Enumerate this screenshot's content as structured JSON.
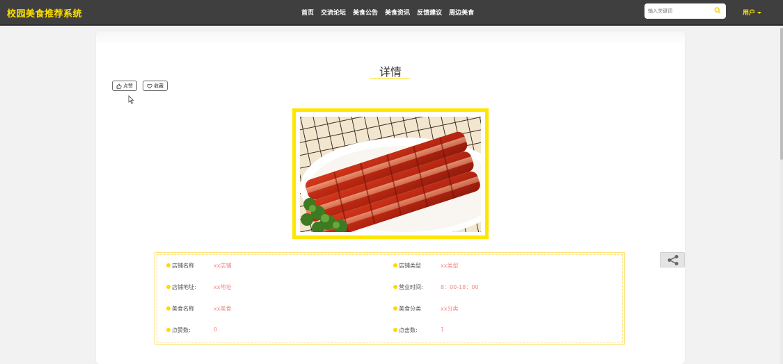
{
  "app": {
    "title": "校园美食推荐系统"
  },
  "nav": {
    "items": [
      "首页",
      "交流论坛",
      "美食公告",
      "美食资讯",
      "反馈建议",
      "周边美食"
    ]
  },
  "search": {
    "placeholder": "输入关键词",
    "icon": "search-icon"
  },
  "user": {
    "label": "用户"
  },
  "page": {
    "title": "详情",
    "like_label": "点赞",
    "favorite_label": "收藏",
    "image_alt": "叉烧美食图片"
  },
  "details": [
    {
      "label": "店铺名称",
      "value": "xx店铺"
    },
    {
      "label": "店铺类型",
      "value": "xx类型"
    },
    {
      "label": "店铺地址:",
      "value": "xx地址"
    },
    {
      "label": "营业时间:",
      "value": "8：00-18：00"
    },
    {
      "label": "美食名称",
      "value": "xx美食"
    },
    {
      "label": "美食分类",
      "value": "xx分类"
    },
    {
      "label": "点赞数:",
      "value": "0"
    },
    {
      "label": "点击数:",
      "value": "1"
    }
  ],
  "colors": {
    "brand": "#ffe100",
    "navbar": "#3f3f3f",
    "frame": "#ffe600",
    "value_text": "#e88888"
  }
}
